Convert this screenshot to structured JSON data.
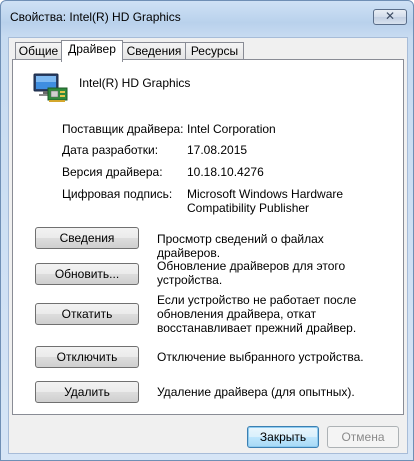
{
  "window": {
    "title": "Свойства: Intel(R) HD Graphics",
    "close_glyph": "✕"
  },
  "tabs": [
    {
      "label": "Общие"
    },
    {
      "label": "Драйвер",
      "active": true
    },
    {
      "label": "Сведения"
    },
    {
      "label": "Ресурсы"
    }
  ],
  "device": {
    "name": "Intel(R) HD Graphics",
    "icon": "display-adapter-icon"
  },
  "properties": [
    {
      "label": "Поставщик драйвера:",
      "value": "Intel Corporation"
    },
    {
      "label": "Дата разработки:",
      "value": "17.08.2015"
    },
    {
      "label": "Версия драйвера:",
      "value": "10.18.10.4276"
    },
    {
      "label": "Цифровая подпись:",
      "value": "Microsoft Windows Hardware Compatibility Publisher"
    }
  ],
  "actions": [
    {
      "button": "Сведения",
      "description": "Просмотр сведений о файлах драйверов."
    },
    {
      "button": "Обновить...",
      "description": "Обновление драйверов для этого устройства."
    },
    {
      "button": "Откатить",
      "description": "Если устройство не работает после обновления драйвера, откат восстанавливает прежний драйвер."
    },
    {
      "button": "Отключить",
      "description": "Отключение выбранного устройства."
    },
    {
      "button": "Удалить",
      "description": "Удаление драйвера (для опытных)."
    }
  ],
  "footer": {
    "ok_label": "Закрыть",
    "cancel_label": "Отмена"
  },
  "colors": {
    "title_bar": "#c7dbf1",
    "window_border": "#6f8fb5",
    "panel_bg": "#ffffff",
    "dialog_bg": "#f0f0f0"
  }
}
